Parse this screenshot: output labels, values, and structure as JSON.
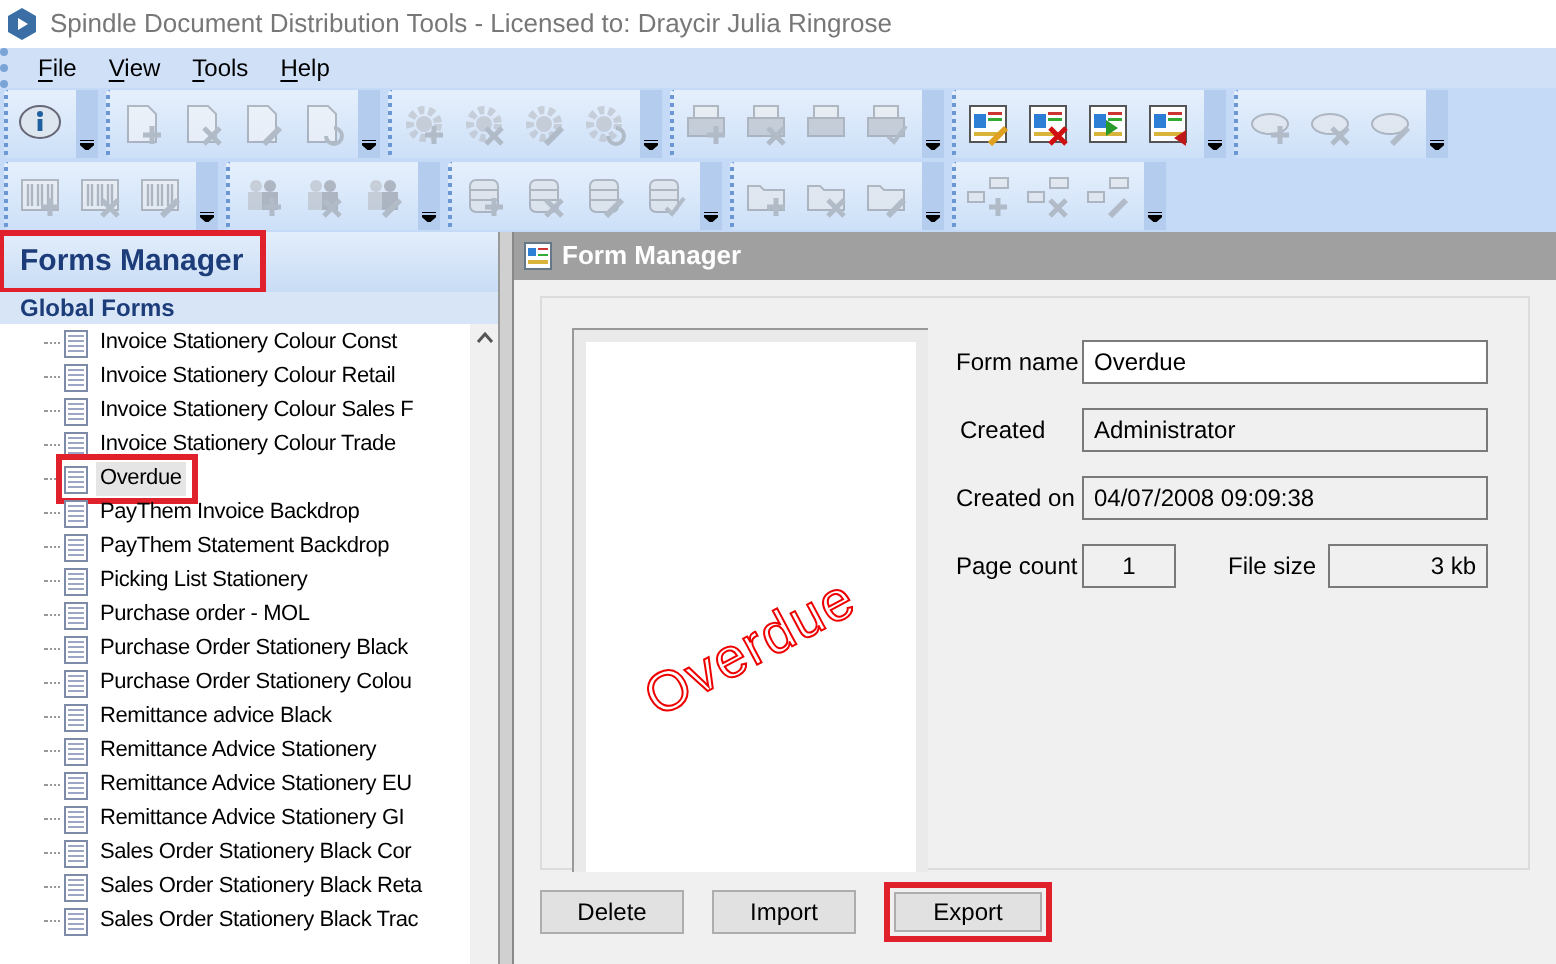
{
  "window": {
    "title": "Spindle Document Distribution Tools - Licensed to: Draycir Julia Ringrose"
  },
  "menu": [
    {
      "label": "File"
    },
    {
      "label": "View"
    },
    {
      "label": "Tools"
    },
    {
      "label": "Help"
    }
  ],
  "toolbars": [
    [
      {
        "kind": "info",
        "items": [
          {
            "kind": "none",
            "disabled": false
          }
        ]
      },
      {
        "kind": "document",
        "items": [
          {
            "kind": "add",
            "disabled": true
          },
          {
            "kind": "delete",
            "disabled": true
          },
          {
            "kind": "edit",
            "disabled": true
          },
          {
            "kind": "refresh",
            "disabled": true
          }
        ]
      },
      {
        "kind": "gear",
        "items": [
          {
            "kind": "add",
            "disabled": true
          },
          {
            "kind": "delete",
            "disabled": true
          },
          {
            "kind": "edit",
            "disabled": true
          },
          {
            "kind": "refresh",
            "disabled": true
          }
        ]
      },
      {
        "kind": "printer",
        "items": [
          {
            "kind": "add",
            "disabled": true
          },
          {
            "kind": "delete",
            "disabled": true
          },
          {
            "kind": "none",
            "disabled": true
          },
          {
            "kind": "check",
            "disabled": true
          }
        ]
      },
      {
        "kind": "form",
        "items": [
          {
            "kind": "edit",
            "disabled": false
          },
          {
            "kind": "delete",
            "disabled": false
          },
          {
            "kind": "import",
            "disabled": false
          },
          {
            "kind": "export",
            "disabled": false
          }
        ]
      },
      {
        "kind": "cloud",
        "items": [
          {
            "kind": "add",
            "disabled": true
          },
          {
            "kind": "delete",
            "disabled": true
          },
          {
            "kind": "edit",
            "disabled": true
          }
        ]
      }
    ],
    [
      {
        "kind": "barcode",
        "items": [
          {
            "kind": "add",
            "disabled": true
          },
          {
            "kind": "delete",
            "disabled": true
          },
          {
            "kind": "edit",
            "disabled": true
          }
        ]
      },
      {
        "kind": "users",
        "items": [
          {
            "kind": "add",
            "disabled": true
          },
          {
            "kind": "delete",
            "disabled": true
          },
          {
            "kind": "edit",
            "disabled": true
          }
        ]
      },
      {
        "kind": "database",
        "items": [
          {
            "kind": "add",
            "disabled": true
          },
          {
            "kind": "delete",
            "disabled": true
          },
          {
            "kind": "edit",
            "disabled": true
          },
          {
            "kind": "check",
            "disabled": true
          }
        ]
      },
      {
        "kind": "folder",
        "items": [
          {
            "kind": "add",
            "disabled": true
          },
          {
            "kind": "delete",
            "disabled": true
          },
          {
            "kind": "edit",
            "disabled": true
          }
        ]
      },
      {
        "kind": "nodes",
        "items": [
          {
            "kind": "add",
            "disabled": true
          },
          {
            "kind": "delete",
            "disabled": true
          },
          {
            "kind": "edit",
            "disabled": true
          }
        ]
      }
    ]
  ],
  "sidebar": {
    "title": "Forms Manager",
    "title_highlighted": true,
    "section": "Global Forms",
    "items": [
      {
        "label": "Invoice Stationery Colour Const",
        "selected": false,
        "highlighted": false
      },
      {
        "label": "Invoice Stationery Colour Retail",
        "selected": false,
        "highlighted": false
      },
      {
        "label": "Invoice Stationery Colour Sales F",
        "selected": false,
        "highlighted": false
      },
      {
        "label": "Invoice Stationery Colour Trade",
        "selected": false,
        "highlighted": false
      },
      {
        "label": "Overdue",
        "selected": true,
        "highlighted": true
      },
      {
        "label": "PayThem Invoice Backdrop",
        "selected": false,
        "highlighted": false
      },
      {
        "label": "PayThem Statement Backdrop",
        "selected": false,
        "highlighted": false
      },
      {
        "label": "Picking List Stationery",
        "selected": false,
        "highlighted": false
      },
      {
        "label": "Purchase order - MOL",
        "selected": false,
        "highlighted": false
      },
      {
        "label": "Purchase Order Stationery Black",
        "selected": false,
        "highlighted": false
      },
      {
        "label": "Purchase Order Stationery Colou",
        "selected": false,
        "highlighted": false
      },
      {
        "label": "Remittance advice Black",
        "selected": false,
        "highlighted": false
      },
      {
        "label": "Remittance Advice Stationery",
        "selected": false,
        "highlighted": false
      },
      {
        "label": "Remittance Advice Stationery EU",
        "selected": false,
        "highlighted": false
      },
      {
        "label": "Remittance Advice Stationery GI",
        "selected": false,
        "highlighted": false
      },
      {
        "label": "Sales Order Stationery Black Cor",
        "selected": false,
        "highlighted": false
      },
      {
        "label": "Sales Order Stationery Black Reta",
        "selected": false,
        "highlighted": false
      },
      {
        "label": "Sales Order Stationery Black Trac",
        "selected": false,
        "highlighted": false
      }
    ]
  },
  "panel": {
    "title": "Form Manager",
    "preview_text": "Overdue",
    "form_name": {
      "label": "Form name",
      "value": "Overdue"
    },
    "created": {
      "label": "Created",
      "value": "Administrator"
    },
    "created_on": {
      "label": "Created on",
      "value": "04/07/2008 09:09:38"
    },
    "page_count": {
      "label": "Page count",
      "value": "1"
    },
    "file_size": {
      "label": "File size",
      "value": "3 kb"
    },
    "buttons": [
      {
        "label": "Delete",
        "highlighted": false
      },
      {
        "label": "Import",
        "highlighted": false
      },
      {
        "label": "Export",
        "highlighted": true
      }
    ]
  }
}
